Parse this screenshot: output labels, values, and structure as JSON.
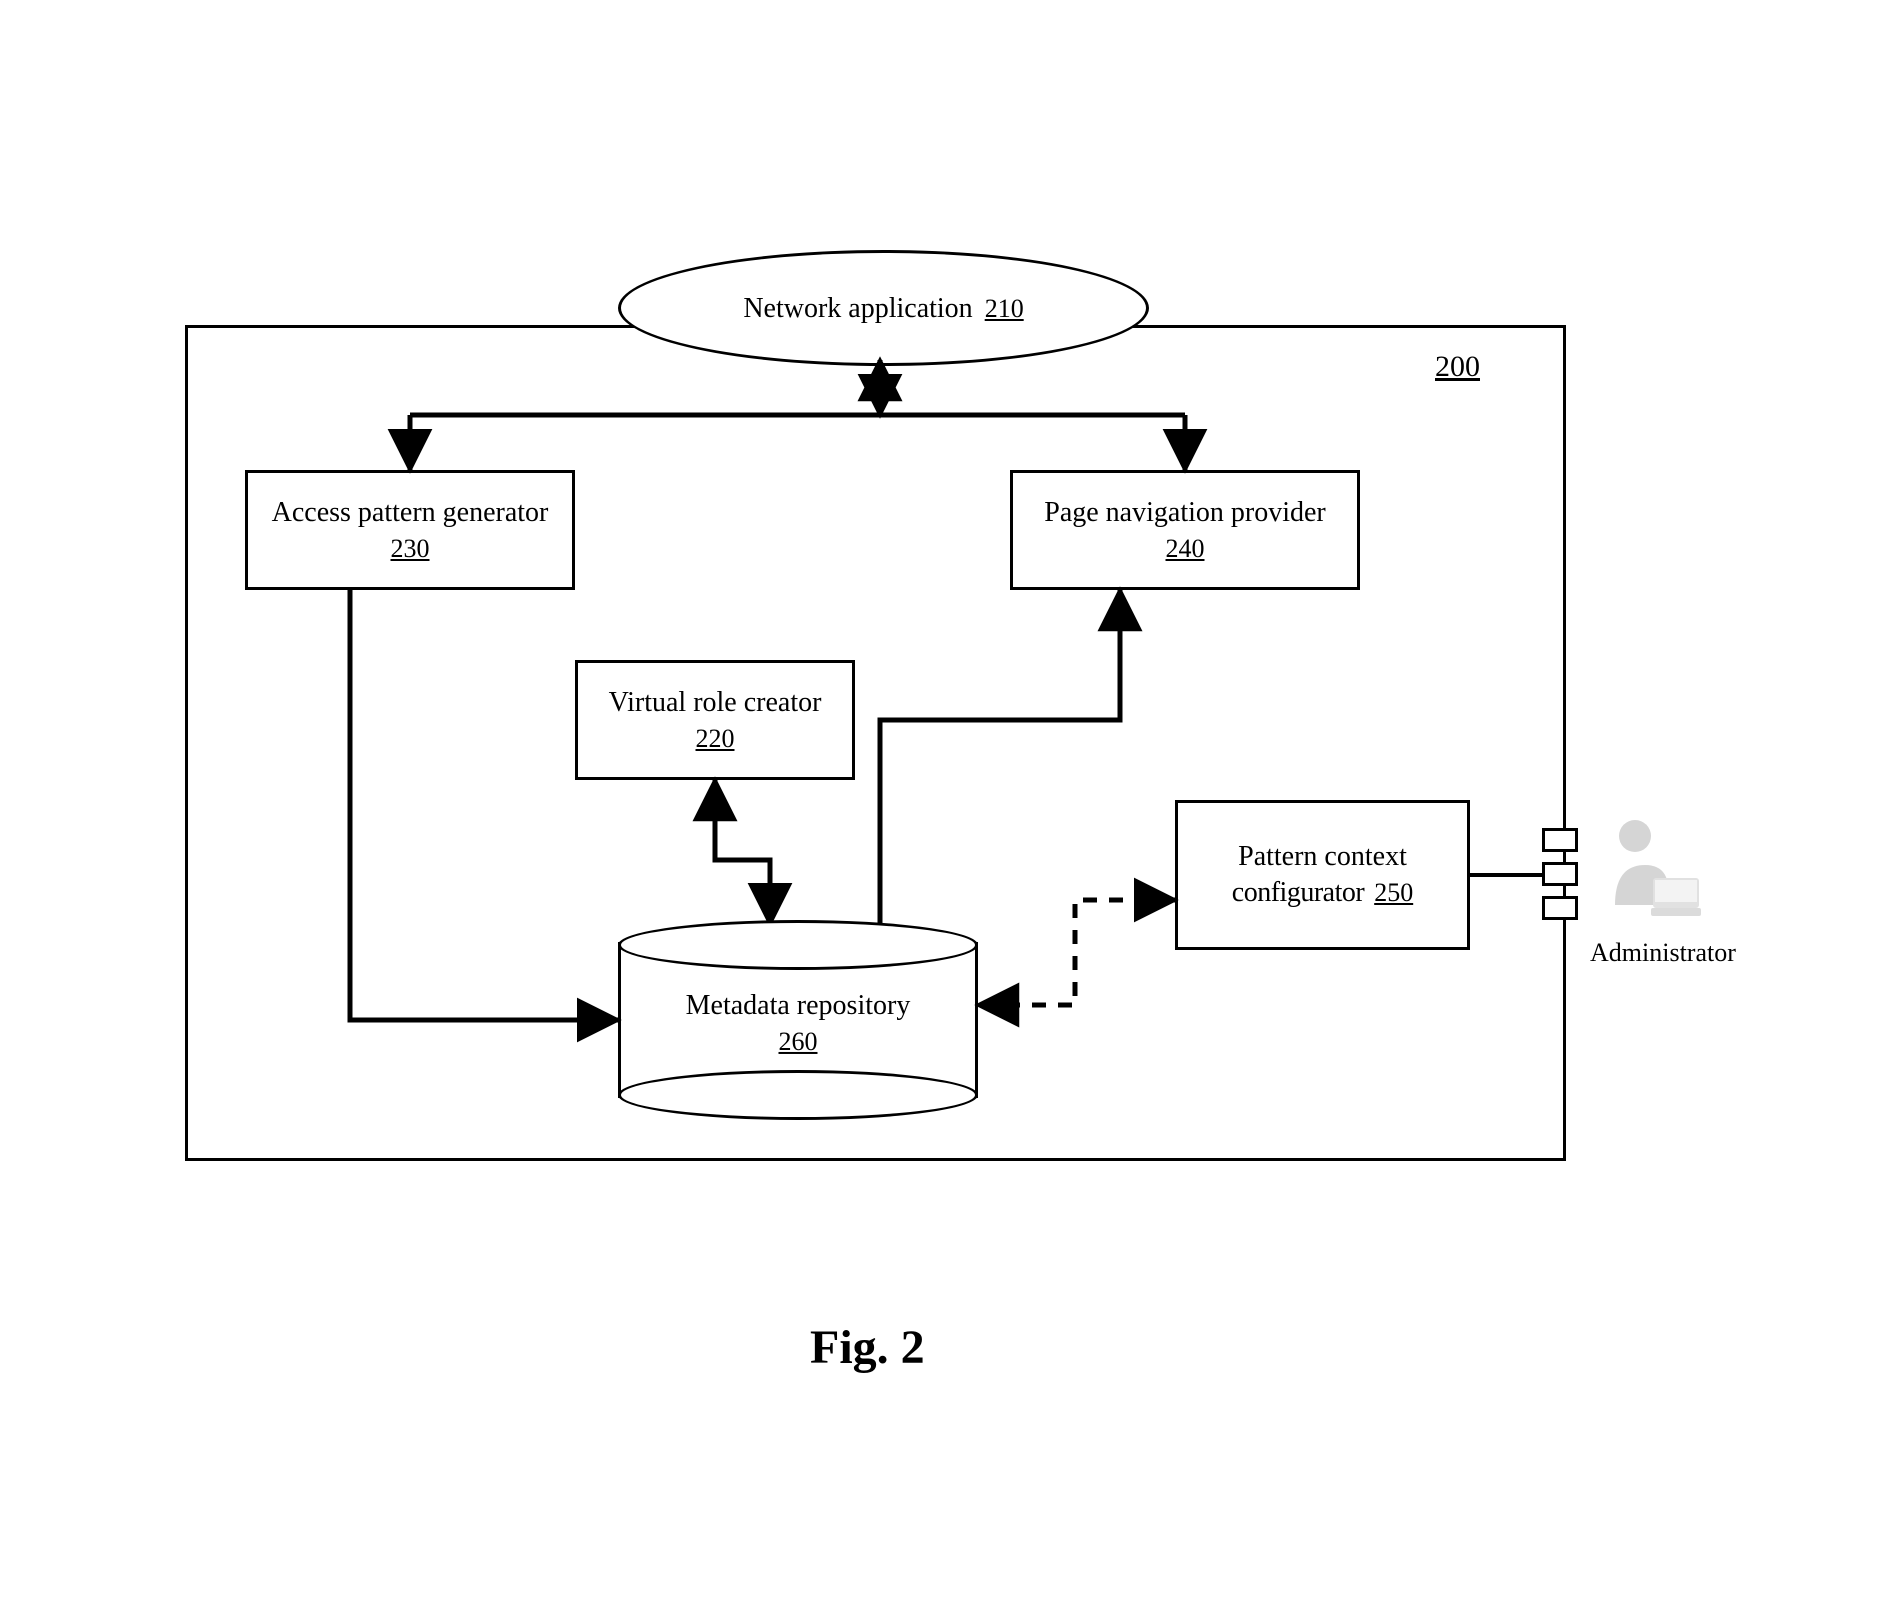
{
  "figure_caption": "Fig. 2",
  "system": {
    "ref": "200"
  },
  "network_app": {
    "label": "Network application",
    "ref": "210"
  },
  "access_pattern_generator": {
    "label": "Access pattern generator",
    "ref": "230"
  },
  "virtual_role_creator": {
    "label": "Virtual role creator",
    "ref": "220"
  },
  "page_navigation_provider": {
    "label": "Page navigation provider",
    "ref": "240"
  },
  "pattern_context_configurator": {
    "label1": "Pattern context",
    "label2": "configurator",
    "ref": "250"
  },
  "metadata_repository": {
    "label": "Metadata repository",
    "ref": "260"
  },
  "administrator": {
    "label": "Administrator"
  }
}
